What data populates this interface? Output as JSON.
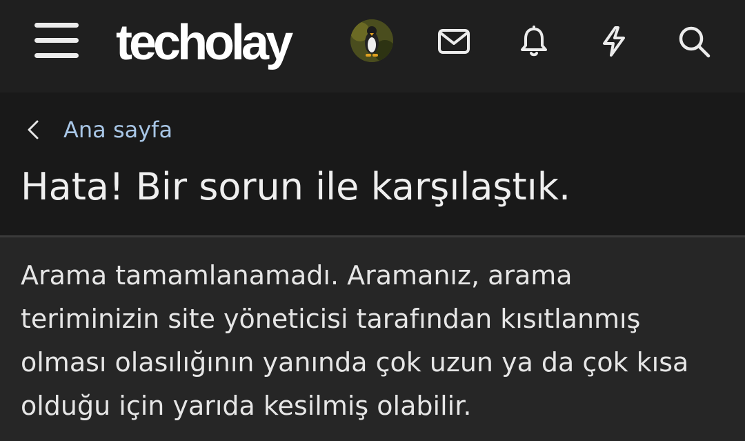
{
  "header": {
    "logo_text": "techolay",
    "icons": [
      "menu-icon",
      "avatar",
      "mail-icon",
      "bell-icon",
      "bolt-icon",
      "search-icon"
    ]
  },
  "breadcrumb": {
    "label": "Ana sayfa"
  },
  "page": {
    "title": "Hata! Bir sorun ile karşılaştık.",
    "message": "Arama tamamlanamadı. Aramanız, arama teriminizin site yöneticisi tarafından kısıtlanmış olması olasılığının yanında çok uzun ya da çok kısa olduğu için yarıda kesilmiş olabilir."
  },
  "colors": {
    "topbar_bg": "#1f1f1f",
    "header_bg": "#191919",
    "body_bg": "#262626",
    "link": "#a8c6e6",
    "text": "#e6e6e6"
  }
}
